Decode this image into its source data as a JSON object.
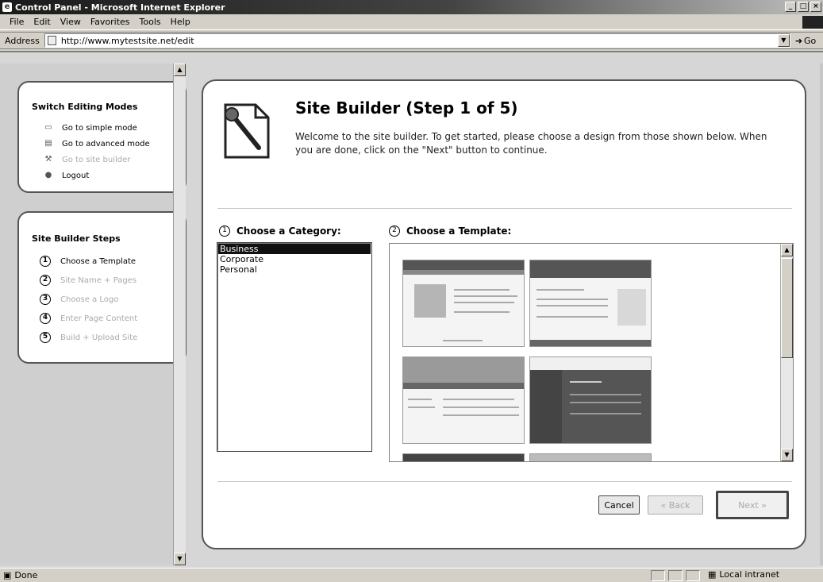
{
  "window": {
    "title": "Control Panel - Microsoft Internet Explorer",
    "controls": [
      "_",
      "□",
      "×"
    ]
  },
  "menu": [
    "File",
    "Edit",
    "View",
    "Favorites",
    "Tools",
    "Help"
  ],
  "address": {
    "label": "Address",
    "url": "http://www.mytestsite.net/edit",
    "go": "Go"
  },
  "sidebar": {
    "modes": {
      "heading": "Switch Editing Modes",
      "items": [
        {
          "label": "Go to simple mode",
          "icon": "simple-mode-icon",
          "enabled": true
        },
        {
          "label": "Go to advanced mode",
          "icon": "advanced-mode-icon",
          "enabled": true
        },
        {
          "label": "Go to site builder",
          "icon": "site-builder-icon",
          "enabled": false
        },
        {
          "label": "Logout",
          "icon": "logout-icon",
          "enabled": true
        }
      ]
    },
    "steps": {
      "heading": "Site Builder Steps",
      "items": [
        {
          "num": "1",
          "label": "Choose a Template",
          "enabled": true
        },
        {
          "num": "2",
          "label": "Site Name + Pages",
          "enabled": false
        },
        {
          "num": "3",
          "label": "Choose a Logo",
          "enabled": false
        },
        {
          "num": "4",
          "label": "Enter Page Content",
          "enabled": false
        },
        {
          "num": "5",
          "label": "Build + Upload Site",
          "enabled": false
        }
      ]
    }
  },
  "main": {
    "title": "Site Builder (Step 1 of 5)",
    "intro": "Welcome to the site builder. To get started, please choose a design from those shown below. When you are done, click on the \"Next\" button to continue.",
    "category": {
      "num": "1",
      "label": "Choose a Category:",
      "options": [
        "Business",
        "Corporate",
        "Personal"
      ],
      "selected": "Business"
    },
    "template": {
      "num": "2",
      "label": "Choose a Template:"
    },
    "buttons": {
      "cancel": "Cancel",
      "back": "« Back",
      "next": "Next »"
    }
  },
  "status": {
    "text": "Done",
    "zone": "Local intranet"
  }
}
